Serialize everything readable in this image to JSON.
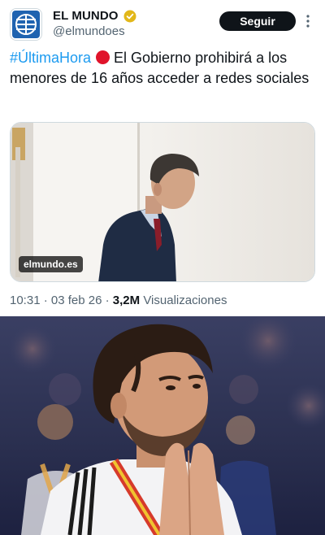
{
  "account": {
    "name": "EL MUNDO",
    "handle": "@elmundoes",
    "follow_label": "Seguir"
  },
  "tweet": {
    "hashtag": "#ÚltimaHora",
    "body": "El Gobierno prohibirá a los menores de 16 años acceder a redes sociales"
  },
  "media": {
    "source": "elmundo.es"
  },
  "meta": {
    "time": "10:31",
    "date": "03 feb 26",
    "views": "3,2M",
    "views_label": "Visualizaciones"
  },
  "colors": {
    "accent": "#1d9bf0",
    "logo_blue": "#1f63b0",
    "verified_gold": "#e2b719",
    "alert_red": "#e0142b"
  }
}
